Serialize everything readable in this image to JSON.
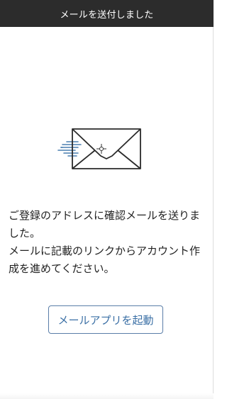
{
  "header": {
    "title": "メールを送付しました"
  },
  "illustration": {
    "icon": "mail-sent-icon",
    "line_color": "#2a2a2a",
    "speed_lines_color": "#4a7fb0"
  },
  "message": {
    "line1": "ご登録のアドレスに確認メールを送りました。",
    "line2": "メールに記載のリンクからアカウント作成を進めてください。"
  },
  "launch_button": {
    "label": "メールアプリを起動"
  },
  "colors": {
    "header_bg": "#2c2c2c",
    "accent": "#3a6fa5"
  }
}
